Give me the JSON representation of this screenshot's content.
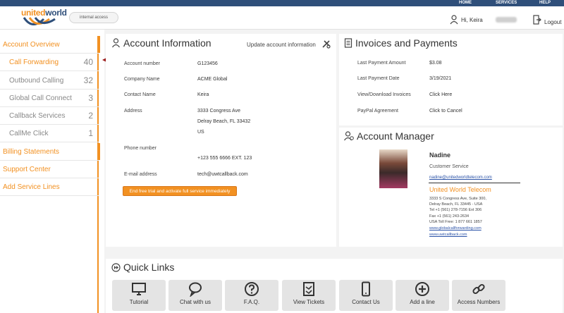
{
  "topnav": {
    "home": "HOME",
    "services": "SERVICES",
    "help": "HELP"
  },
  "brand": {
    "logo_part1": "united",
    "logo_part2": "world",
    "internal_access": "internal access"
  },
  "user": {
    "greeting": "Hi, Keira",
    "logout": "Logout"
  },
  "sidebar": {
    "account_overview": "Account Overview",
    "items": [
      {
        "label": "Call Forwarding",
        "count": "40"
      },
      {
        "label": "Outbound Calling",
        "count": "32"
      },
      {
        "label": "Global Call Connect",
        "count": "3"
      },
      {
        "label": "Callback Services",
        "count": "2"
      },
      {
        "label": "CallMe Click",
        "count": "1"
      }
    ],
    "billing": "Billing Statements",
    "support": "Support Center",
    "add_lines": "Add Service Lines"
  },
  "account_info": {
    "title": "Account Information",
    "update": "Update account information",
    "account_number_label": "Account number",
    "account_number": "G123456",
    "company_label": "Company Name",
    "company": "ACME Global",
    "contact_label": "Contact Name",
    "contact": "Keira",
    "address_label": "Address",
    "address1": "3333 Congress Ave",
    "address2": "Delray Beach, FL 33432",
    "address3": "US",
    "phone_label": "Phone number",
    "phone": "+123 555 6666 EXT. 123",
    "email_label": "E-mail address",
    "email": "tech@uwtcallback.com",
    "cta": "End free trial and activate full service immediately"
  },
  "invoices": {
    "title": "Invoices and Payments",
    "last_amount_label": "Last Payment Amount",
    "last_amount": "$3.08",
    "last_date_label": "Last Payment Date",
    "last_date": "3/19/2021",
    "view_label": "View/Download Invoices",
    "view_link": "Click Here",
    "paypal_label": "PayPal Agreement",
    "paypal_link": "Click to Cancel"
  },
  "manager": {
    "title": "Account Manager",
    "name": "Nadine",
    "role": "Customer Service",
    "email": "nadine@unitedworldtelecom.com",
    "company": "United World Telecom",
    "addr1": "3333 S Congress Ave, Suite 300,",
    "addr2": "Delray Beach, FL 33445 - USA",
    "tel": "Tel +1 (561) 278-7156 Ext 306",
    "fax": "Fax +1 (561) 243-2634",
    "tollfree": "USA Toll Free: 1 877 661 1857",
    "web1": "www.globalcallforwarding.com",
    "web2": "www.uwtcallback.com"
  },
  "quick_links": {
    "title": "Quick Links",
    "items": [
      {
        "label": "Tutorial",
        "icon": "monitor-icon"
      },
      {
        "label": "Chat with us",
        "icon": "chat-bubble-icon"
      },
      {
        "label": "F.A.Q.",
        "icon": "question-icon"
      },
      {
        "label": "View Tickets",
        "icon": "ticket-icon"
      },
      {
        "label": "Contact Us",
        "icon": "phone-icon"
      },
      {
        "label": "Add a line",
        "icon": "plus-circle-icon"
      },
      {
        "label": "Access Numbers",
        "icon": "link-icon"
      }
    ]
  },
  "colors": {
    "accent": "#f29122",
    "navy": "#2f4f7a",
    "link": "#2b53a8",
    "arrow": "#9b1c1c"
  }
}
